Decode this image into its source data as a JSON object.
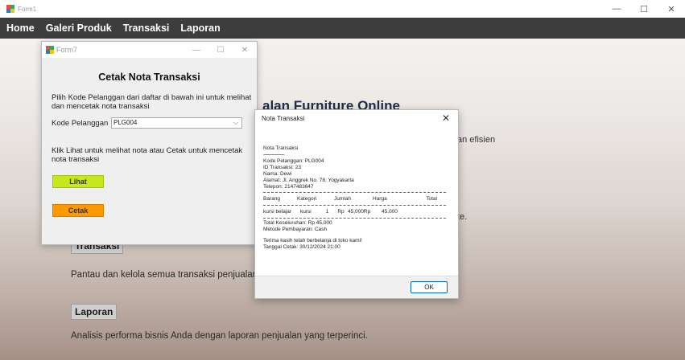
{
  "window": {
    "title": "Form1",
    "minimize": "—",
    "maximize": "☐",
    "close": "✕"
  },
  "menu": {
    "items": [
      "Home",
      "Galeri Produk",
      "Transaksi",
      "Laporan"
    ]
  },
  "background": {
    "heading_fragment": "alan Furniture Online",
    "fragment_efisien": "an efisien",
    "fragment_te": "te.",
    "sections": {
      "transaksi_title": "Transaksi",
      "transaksi_text": "Pantau dan kelola semua transaksi penjualan se",
      "laporan_title": "Laporan",
      "laporan_text": "Analisis performa bisnis Anda dengan laporan penjualan yang terperinci."
    }
  },
  "form7": {
    "title": "Form7",
    "heading": "Cetak Nota Transaksi",
    "description": "Pilih Kode Pelanggan dari daftar di bawah ini untuk melihat dan mencetak nota transaksi",
    "kode_label": "Kode Pelanggan",
    "kode_value": "PLG004",
    "instruction": "Klik Lihat untuk melihat nota atau Cetak untuk mencetak nota transaksi",
    "btn_lihat": "Lihat",
    "btn_cetak": "Cetak",
    "colors": {
      "lihat": "#c8e61c",
      "cetak": "#ff9900"
    }
  },
  "nota": {
    "title": "Nota Transaksi",
    "header": "Nota Transaksi",
    "sep1": "----------------------",
    "kode_pelanggan": "Kode Pelanggan: PLG004",
    "id_transaksi": "ID Transaksi: 23",
    "nama": "Nama: Dewi",
    "alamat": "Alamat: Jl. Anggrek No. 78, Yogyakarta",
    "telepon": "Telepon: 2147483647",
    "columns": [
      "Barang",
      "Kategori",
      "Jumlah",
      "Harga",
      "Total"
    ],
    "item": [
      "kursi belajar",
      "kursi",
      "1",
      "Rp",
      "45,000Rp",
      "45,000"
    ],
    "total": "Total Keseluruhan: Rp 45,000",
    "metode": "Metode Pembayaran: Cash",
    "thanks": "Terima kasih telah berbelanja di toko kami!",
    "tanggal": "Tanggal Cetak: 30/12/2024 21:00",
    "ok": "OK"
  }
}
